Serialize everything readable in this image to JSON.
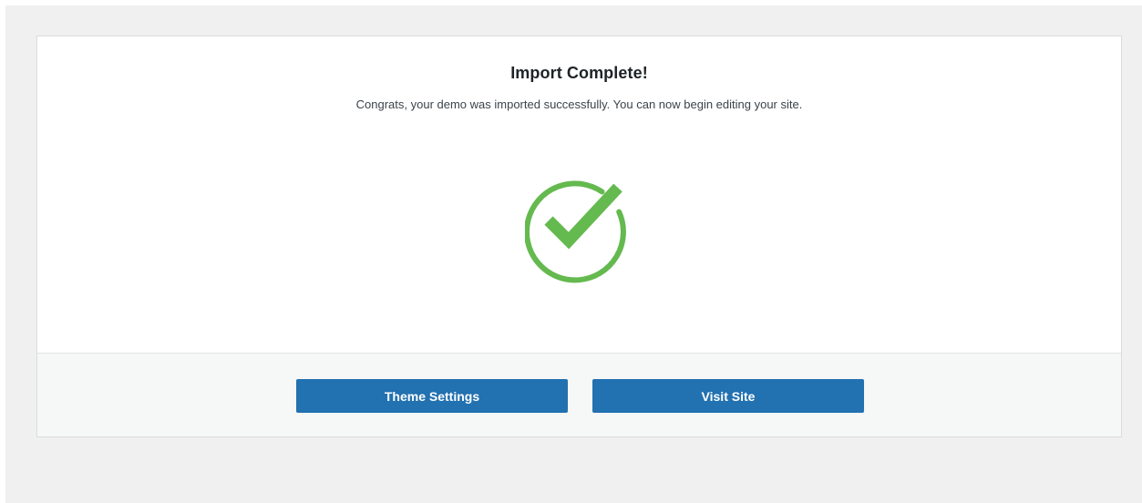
{
  "import": {
    "title": "Import Complete!",
    "message": "Congrats, your demo was imported successfully. You can now begin editing your site.",
    "status_icon": "checkmark-circle-icon",
    "accent_color": "#64b94f"
  },
  "actions": {
    "theme_settings_label": "Theme Settings",
    "visit_site_label": "Visit Site",
    "button_color": "#2271b1"
  }
}
